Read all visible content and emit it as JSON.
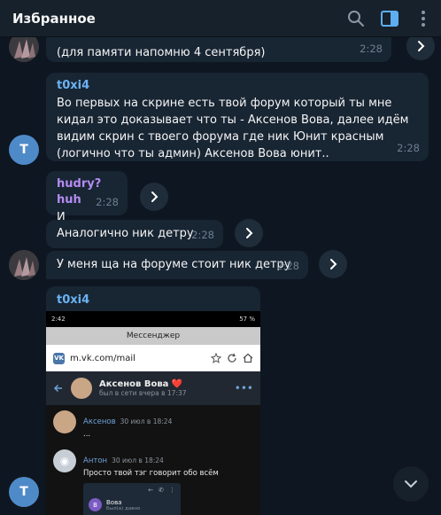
{
  "header": {
    "title": "Избранное"
  },
  "messages": {
    "m1": {
      "text": "(для памяти напомню 4 сентября)",
      "time": "2:28"
    },
    "m2": {
      "sender": "t0xi4",
      "text": "Во первых на скрине есть твой форум который ты мне кидал это доказывает что ты - Аксенов Вова, далее идём видим скрин с твоего форума где ник Юнит красным (логично что ты админ) Аксенов Вова юнит..",
      "time": "2:28",
      "avatar_letter": "T"
    },
    "m3": {
      "sender": "hudry?huh",
      "text": "И",
      "time": "2:28"
    },
    "m4": {
      "text": "Аналогично ник детру",
      "time": "2:28"
    },
    "m5": {
      "text": "У меня ща на форуме стоит ник детру",
      "time": "2:28"
    },
    "m6": {
      "sender": "t0xi4",
      "avatar_letter": "T"
    }
  },
  "screenshot": {
    "status_time": "2:42",
    "status_battery": "57 %",
    "app_title": "Мессенджер",
    "url": "m.vk.com/mail",
    "chat_name": "Аксенов Вова ❤️",
    "chat_status": "был в сети вчера в 17:37",
    "msg1": {
      "name": "Аксенов",
      "date": "30 июл в 18:24",
      "text": "..."
    },
    "msg2": {
      "name": "Антон",
      "date": "30 июл в 18:24",
      "text": "Просто твой тэг говорит обо всём"
    },
    "inner": {
      "name": "Вова",
      "sub": "Был(а) давно",
      "letter": "В"
    }
  },
  "colors": {
    "sender_blue": "#6ab3f3",
    "sender_purple": "#b48cf2",
    "bubble": "#182533",
    "background": "#0e1621"
  }
}
